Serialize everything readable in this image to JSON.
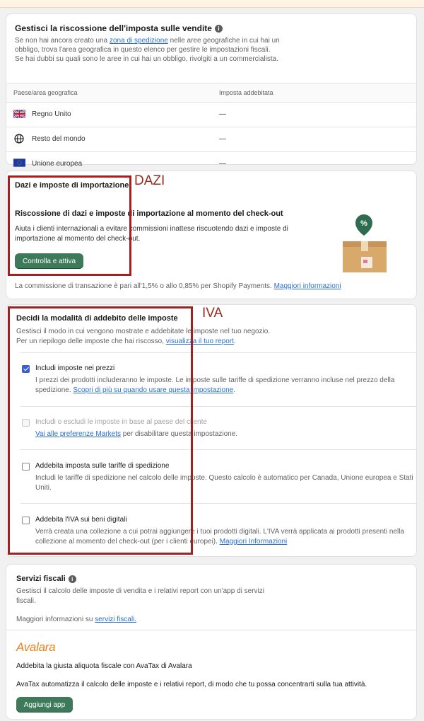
{
  "collection_card": {
    "title": "Gestisci la riscossione dell'imposta sulle vendite",
    "desc_before_link": "Se non hai ancora creato una",
    "desc_link": "zona di spedizione",
    "desc_after_link": "nelle aree geografiche in cui hai un obbligo, trova l'area geografica in questo elenco per gestire le impostazioni fiscali.",
    "desc_line2": "Se hai dubbi su quali sono le aree in cui hai un obbligo, rivolgiti a un commercialista.",
    "col_country": "Paese/area geografica",
    "col_tax": "Imposta addebitata",
    "rows": [
      {
        "country": "Regno Unito",
        "tax": "—",
        "icon": "uk-flag-icon"
      },
      {
        "country": "Resto del mondo",
        "tax": "—",
        "icon": "globe-icon"
      },
      {
        "country": "Unione europea",
        "tax": "—",
        "icon": "eu-flag-icon"
      }
    ]
  },
  "duties_card": {
    "title": "Dazi e imposte di importazione",
    "subtitle": "Riscossione di dazi e imposte di importazione al momento del check-out",
    "description": "Aiuta i clienti internazionali a evitare commissioni inattese riscuotendo dazi e imposte di importazione al momento del check-out.",
    "button": "Controlla e attiva",
    "fee_text": "La commissione di transazione è pari all'1,5% o allo 0,85% per Shopify Payments.",
    "fee_link": "Maggiori informazioni",
    "annotation": "DAZI"
  },
  "charging_card": {
    "title": "Decidi la modalità di addebito delle imposte",
    "desc1": "Gestisci il modo in cui vengono mostrate e addebitate le imposte nel tuo negozio.",
    "desc2_before": "Per un riepilogo delle imposte che hai riscosso,",
    "desc2_link": "visualizza il tuo report",
    "desc2_after": ".",
    "annotation": "IVA",
    "options": [
      {
        "label": "Includi imposte nei prezzi",
        "checked": true,
        "disabled": false,
        "desc": "I prezzi dei prodotti includeranno le imposte. Le imposte sulle tariffe di spedizione verranno incluse nel prezzo della spedizione.",
        "link": "Scopri di più su quando usare questa impostazione",
        "after": "."
      },
      {
        "label": "Includi o escludi le imposte in base al paese del cliente",
        "checked": false,
        "disabled": true,
        "link": "Vai alle preferenze Markets",
        "after": "per disabilitare questa impostazione."
      },
      {
        "label": "Addebita imposta sulle tariffe di spedizione",
        "checked": false,
        "disabled": false,
        "desc": "Includi le tariffe di spedizione nel calcolo delle imposte. Questo calcolo è automatico per Canada, Unione europea e Stati Uniti."
      },
      {
        "label": "Addebita l'IVA sui beni digitali",
        "checked": false,
        "disabled": false,
        "desc": "Verrà creata una collezione a cui potrai aggiungere i tuoi prodotti digitali. L'IVA verrà applicata ai prodotti presenti nella collezione al momento del check-out (per i clienti europei).",
        "link": "Maggiori Informazioni"
      }
    ]
  },
  "services_card": {
    "title": "Servizi fiscali",
    "desc": "Gestisci il calcolo delle imposte di vendita e i relativi report con un'app di servizi fiscali.",
    "more_before": "Maggiori informazioni su",
    "more_link": "servizi fiscali.",
    "brand": "Avalara",
    "headline": "Addebita la giusta aliquota fiscale con AvaTax di Avalara",
    "body": "AvaTax automatizza il calcolo delle imposte e i relativi report, di modo che tu possa concentrarti sulla tua attività.",
    "button": "Aggiungi app"
  },
  "colors": {
    "primary_button": "#3c7a5a",
    "link": "#2c6ecb",
    "annotation_red": "#a41f1f",
    "avalara_orange": "#f0801c"
  }
}
